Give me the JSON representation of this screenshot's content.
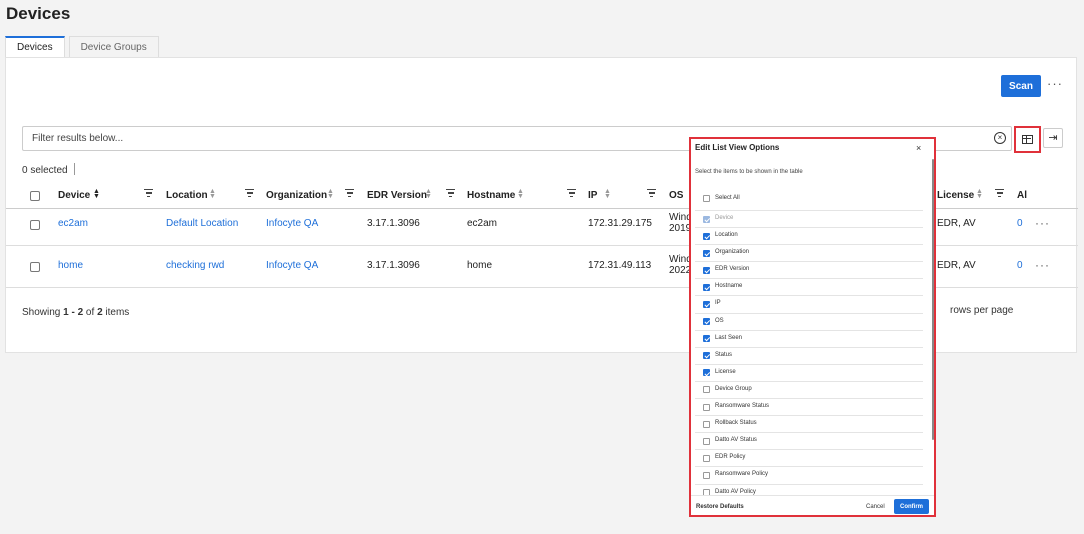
{
  "page": {
    "title": "Devices"
  },
  "tabs": [
    {
      "label": "Devices",
      "active": true
    },
    {
      "label": "Device Groups",
      "active": false
    }
  ],
  "toolbar": {
    "scan_label": "Scan",
    "more_label": "···",
    "export_icon": "export-icon",
    "columns_icon": "columns-icon"
  },
  "filter": {
    "placeholder": "Filter results below...",
    "clear_label": "×"
  },
  "selection": {
    "text": "0 selected"
  },
  "table": {
    "columns": [
      "Device",
      "Location",
      "Organization",
      "EDR Version",
      "Hostname",
      "IP",
      "OS",
      "License",
      "Al"
    ],
    "rows": [
      {
        "device": "ec2am",
        "location": "Default Location",
        "organization": "Infocyte QA",
        "edr_version": "3.17.1.3096",
        "hostname": "ec2am",
        "ip": "172.31.29.175",
        "os": "Windows 2019",
        "license": "EDR, AV",
        "alerts": "0",
        "more": "···"
      },
      {
        "device": "home",
        "location": "checking rwd",
        "organization": "Infocyte QA",
        "edr_version": "3.17.1.3096",
        "hostname": "home",
        "ip": "172.31.49.113",
        "os": "Windows 2022",
        "license": "EDR, AV",
        "alerts": "0",
        "more": "···"
      }
    ]
  },
  "pagination": {
    "showing_prefix": "Showing ",
    "range": "1 - 2",
    "of_text": " of ",
    "total": "2",
    "items_text": " items",
    "rows_per_page": "rows per page"
  },
  "modal": {
    "title": "Edit List View Options",
    "close_label": "×",
    "subtitle": "Select the items to be shown in the table",
    "select_all": "Select All",
    "items": [
      {
        "label": "Device",
        "checked": true,
        "disabled": true
      },
      {
        "label": "Location",
        "checked": true
      },
      {
        "label": "Organization",
        "checked": true
      },
      {
        "label": "EDR Version",
        "checked": true
      },
      {
        "label": "Hostname",
        "checked": true
      },
      {
        "label": "IP",
        "checked": true
      },
      {
        "label": "OS",
        "checked": true
      },
      {
        "label": "Last Seen",
        "checked": true
      },
      {
        "label": "Status",
        "checked": true
      },
      {
        "label": "License",
        "checked": true
      },
      {
        "label": "Device Group",
        "checked": false
      },
      {
        "label": "Ransomware Status",
        "checked": false
      },
      {
        "label": "Rollback Status",
        "checked": false
      },
      {
        "label": "Datto AV Status",
        "checked": false
      },
      {
        "label": "EDR Policy",
        "checked": false
      },
      {
        "label": "Ransomware Policy",
        "checked": false
      },
      {
        "label": "Datto AV Policy",
        "checked": false
      }
    ],
    "restore_label": "Restore Defaults",
    "cancel_label": "Cancel",
    "confirm_label": "Confirm"
  },
  "colors": {
    "accent": "#1e6fd9",
    "highlight": "#e0313a"
  }
}
